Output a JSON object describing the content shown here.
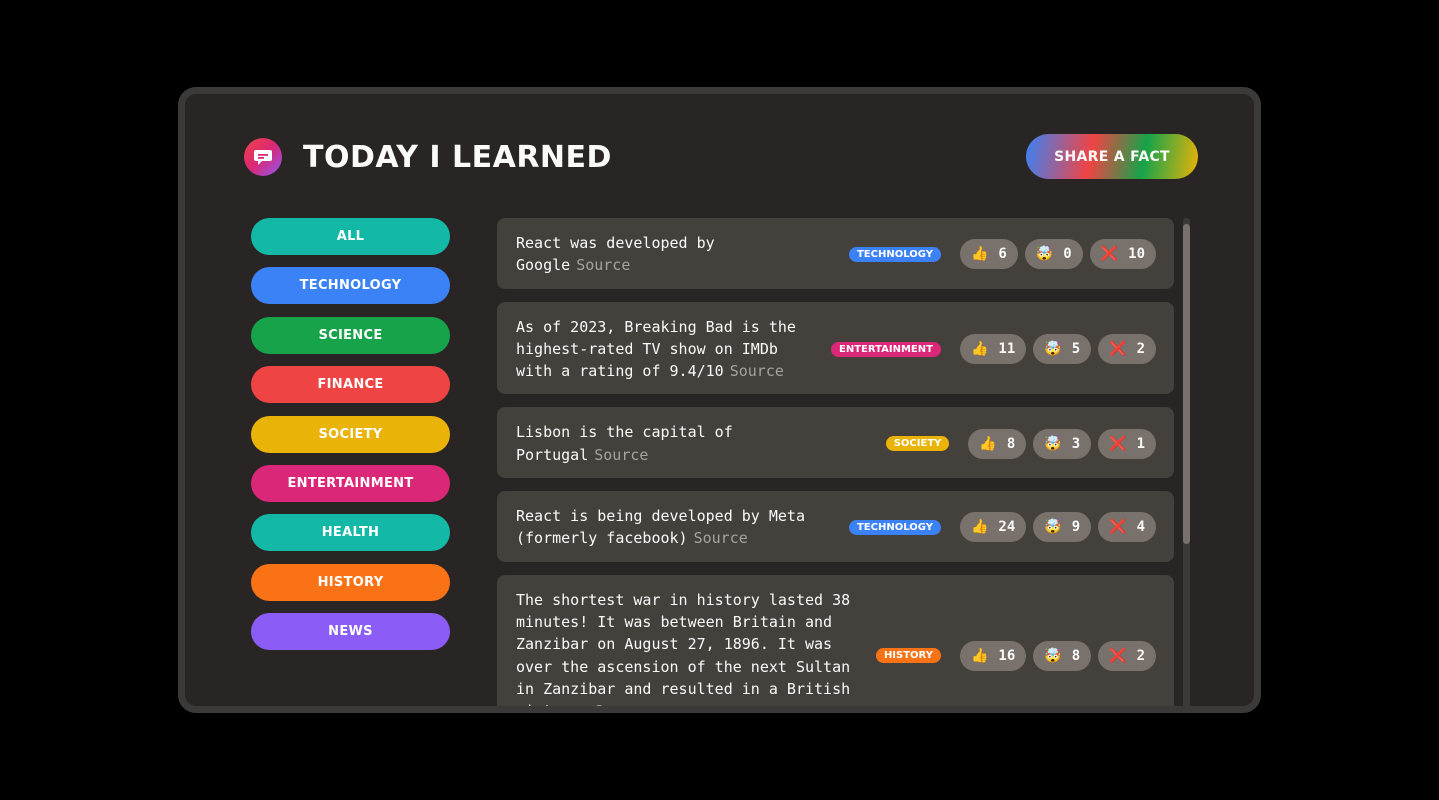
{
  "header": {
    "title": "Today I Learned",
    "share_label": "Share a fact"
  },
  "categories": [
    {
      "label": "All",
      "color": "#14b8a6"
    },
    {
      "label": "Technology",
      "color": "#3b82f6"
    },
    {
      "label": "Science",
      "color": "#16a34a"
    },
    {
      "label": "Finance",
      "color": "#ef4444"
    },
    {
      "label": "Society",
      "color": "#eab308"
    },
    {
      "label": "Entertainment",
      "color": "#db2777"
    },
    {
      "label": "Health",
      "color": "#14b8a6"
    },
    {
      "label": "History",
      "color": "#f97316"
    },
    {
      "label": "News",
      "color": "#8b5cf6"
    }
  ],
  "facts": [
    {
      "text": "React was developed by Google",
      "source_label": "Source",
      "tag": "Technology",
      "tag_color": "#3b82f6",
      "interesting": "6",
      "mindblowing": "0",
      "false": "10"
    },
    {
      "text": "As of 2023, Breaking Bad is the highest-rated TV show on IMDb with a rating of 9.4/10",
      "source_label": "Source",
      "tag": "Entertainment",
      "tag_color": "#db2777",
      "interesting": "11",
      "mindblowing": "5",
      "false": "2"
    },
    {
      "text": "Lisbon is the capital of Portugal",
      "source_label": "Source",
      "tag": "Society",
      "tag_color": "#eab308",
      "interesting": "8",
      "mindblowing": "3",
      "false": "1"
    },
    {
      "text": "React is being developed by Meta (formerly facebook)",
      "source_label": "Source",
      "tag": "Technology",
      "tag_color": "#3b82f6",
      "interesting": "24",
      "mindblowing": "9",
      "false": "4"
    },
    {
      "text": "The shortest war in history lasted 38 minutes! It was between Britain and Zanzibar on August 27, 1896. It was over the ascension of the next Sultan in Zanzibar and resulted in a British victory.",
      "source_label": "Source",
      "tag": "History",
      "tag_color": "#f97316",
      "interesting": "16",
      "mindblowing": "8",
      "false": "2"
    }
  ],
  "vote_icons": {
    "interesting": "thumbs-up-icon",
    "mindblowing": "mind-blown-icon",
    "false": "cross-mark-icon"
  }
}
